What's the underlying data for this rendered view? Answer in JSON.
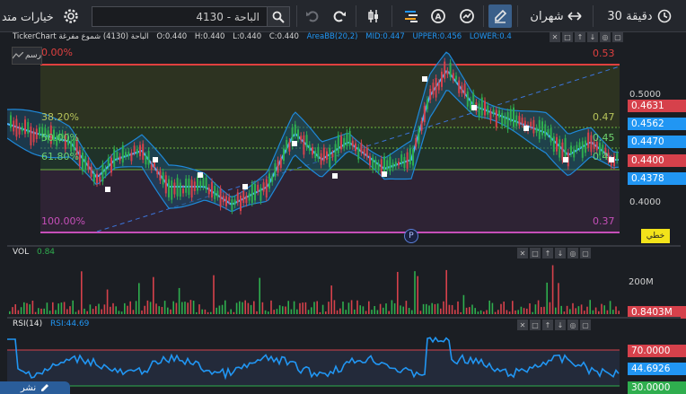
{
  "toolbar": {
    "options_label": "خيارات متد",
    "search_value": "4130 - الباحة",
    "range_label": "شهران",
    "interval_label": "30 دقيقة"
  },
  "ohlc_bar": {
    "name": "TickerChart الباحة (4130) شموع مفرغة",
    "open": "O:0.440",
    "high": "H:0.440",
    "low": "L:0.440",
    "close": "C:0.440",
    "indicator": "AreaBB(20,2)",
    "mid": "MID:0.447",
    "upper": "UPPER:0.456",
    "lower": "LOWER:0.4"
  },
  "main_chart": {
    "overlay_label": "رسم",
    "fib_levels": [
      {
        "left": "0.00%",
        "right": "0.53"
      },
      {
        "left": "38.20%",
        "right": "0.47"
      },
      {
        "left": "50.00%",
        "right": "0.45"
      },
      {
        "left": "61.80%",
        "right": "0.4"
      },
      {
        "left": "100.00%",
        "right": "0.37"
      }
    ],
    "axis_ticks": [
      "0.5000",
      "0.4000"
    ],
    "price_labels": [
      {
        "text": "0.4631",
        "color": "#d6414b"
      },
      {
        "text": "0.4562",
        "color": "#2196f3"
      },
      {
        "text": "0.4470",
        "color": "#2196f3"
      },
      {
        "text": "0.4400",
        "color": "#d6414b"
      },
      {
        "text": "0.4378",
        "color": "#2196f3"
      }
    ],
    "line_button": "خطي",
    "period_marker": "P"
  },
  "volume_pane": {
    "title": "VOL",
    "value": "0.84",
    "axis_tick": "200M",
    "last_label": "0.8403M"
  },
  "rsi_pane": {
    "title": "RSI(14)",
    "value": "RSI:44.69",
    "upper_label": "70.0000",
    "current_label": "44.6926",
    "lower_label": "30.0000"
  },
  "publish_button": "نشر",
  "colors": {
    "up": "#2fae4e",
    "down": "#d6414b",
    "band": "#1f88d8",
    "fib_top": "#e0403f",
    "fib_bottom": "#c64fb9"
  }
}
